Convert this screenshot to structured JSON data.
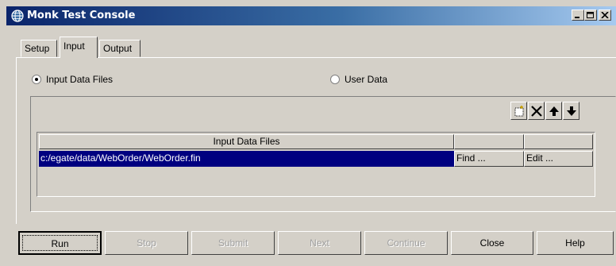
{
  "window": {
    "title": "Monk Test Console"
  },
  "tabs": [
    {
      "label": "Setup",
      "active": false
    },
    {
      "label": "Input",
      "active": true
    },
    {
      "label": "Output",
      "active": false
    }
  ],
  "input_source": {
    "options": [
      {
        "label": "Input Data Files",
        "selected": true
      },
      {
        "label": "User Data",
        "selected": false
      }
    ]
  },
  "toolbar": {
    "icons": [
      "new-row-icon",
      "delete-icon",
      "move-up-icon",
      "move-down-icon"
    ]
  },
  "table": {
    "header": "Input Data Files",
    "rows": [
      {
        "file": "c:/egate/data/WebOrder/WebOrder.fin",
        "find_label": "Find ...",
        "edit_label": "Edit ..."
      }
    ]
  },
  "buttons": {
    "run": "Run",
    "stop": "Stop",
    "submit": "Submit",
    "next": "Next",
    "continue": "Continue",
    "close": "Close",
    "help": "Help"
  },
  "colors": {
    "selection": "#000080",
    "title_bar": "#0a246a"
  }
}
